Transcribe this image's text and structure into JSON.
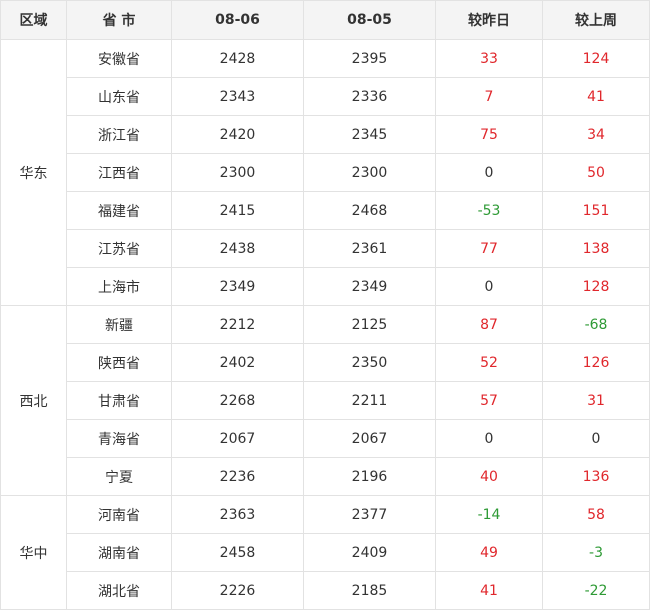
{
  "colors": {
    "up": "#e0272c",
    "down": "#2e9a35",
    "flat": "#333333"
  },
  "table": {
    "headers": [
      "区域",
      "省 市",
      "08-06",
      "08-05",
      "较昨日",
      "较上周"
    ],
    "groups": [
      {
        "region": "华东",
        "rows": [
          {
            "province": "安徽省",
            "d0806": "2428",
            "d0805": "2395",
            "vs_yesterday": "33",
            "vs_last_week": "124"
          },
          {
            "province": "山东省",
            "d0806": "2343",
            "d0805": "2336",
            "vs_yesterday": "7",
            "vs_last_week": "41"
          },
          {
            "province": "浙江省",
            "d0806": "2420",
            "d0805": "2345",
            "vs_yesterday": "75",
            "vs_last_week": "34"
          },
          {
            "province": "江西省",
            "d0806": "2300",
            "d0805": "2300",
            "vs_yesterday": "0",
            "vs_last_week": "50"
          },
          {
            "province": "福建省",
            "d0806": "2415",
            "d0805": "2468",
            "vs_yesterday": "-53",
            "vs_last_week": "151"
          },
          {
            "province": "江苏省",
            "d0806": "2438",
            "d0805": "2361",
            "vs_yesterday": "77",
            "vs_last_week": "138"
          },
          {
            "province": "上海市",
            "d0806": "2349",
            "d0805": "2349",
            "vs_yesterday": "0",
            "vs_last_week": "128"
          }
        ]
      },
      {
        "region": "西北",
        "rows": [
          {
            "province": "新疆",
            "d0806": "2212",
            "d0805": "2125",
            "vs_yesterday": "87",
            "vs_last_week": "-68"
          },
          {
            "province": "陕西省",
            "d0806": "2402",
            "d0805": "2350",
            "vs_yesterday": "52",
            "vs_last_week": "126"
          },
          {
            "province": "甘肃省",
            "d0806": "2268",
            "d0805": "2211",
            "vs_yesterday": "57",
            "vs_last_week": "31"
          },
          {
            "province": "青海省",
            "d0806": "2067",
            "d0805": "2067",
            "vs_yesterday": "0",
            "vs_last_week": "0"
          },
          {
            "province": "宁夏",
            "d0806": "2236",
            "d0805": "2196",
            "vs_yesterday": "40",
            "vs_last_week": "136"
          }
        ]
      },
      {
        "region": "华中",
        "rows": [
          {
            "province": "河南省",
            "d0806": "2363",
            "d0805": "2377",
            "vs_yesterday": "-14",
            "vs_last_week": "58"
          },
          {
            "province": "湖南省",
            "d0806": "2458",
            "d0805": "2409",
            "vs_yesterday": "49",
            "vs_last_week": "-3"
          },
          {
            "province": "湖北省",
            "d0806": "2226",
            "d0805": "2185",
            "vs_yesterday": "41",
            "vs_last_week": "-22"
          }
        ]
      }
    ]
  }
}
